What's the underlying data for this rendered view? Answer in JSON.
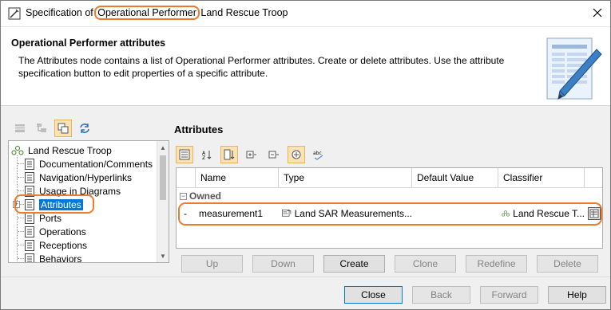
{
  "window": {
    "title_prefix": "Specification of ",
    "title_highlight": "Operational Performer",
    "title_suffix": " Land Rescue Troop"
  },
  "header": {
    "title": "Operational Performer attributes",
    "description": "The Attributes node contains a list of Operational Performer attributes. Create or delete attributes. Use the attribute specification button to edit properties of a specific attribute."
  },
  "tree": {
    "root": "Land Rescue Troop",
    "items": [
      {
        "label": "Documentation/Comments",
        "selected": false
      },
      {
        "label": "Navigation/Hyperlinks",
        "selected": false
      },
      {
        "label": "Usage in Diagrams",
        "selected": false
      },
      {
        "label": "Attributes",
        "selected": true
      },
      {
        "label": "Ports",
        "selected": false
      },
      {
        "label": "Operations",
        "selected": false
      },
      {
        "label": "Receptions",
        "selected": false
      },
      {
        "label": "Behaviors",
        "selected": false
      }
    ]
  },
  "attributes": {
    "title": "Attributes",
    "columns": [
      "Name",
      "Type",
      "Default Value",
      "Classifier"
    ],
    "group_label": "Owned",
    "rows": [
      {
        "marker": "-",
        "name": "measurement1",
        "type": "Land SAR Measurements...",
        "default_value": "",
        "classifier": "Land Rescue T..."
      }
    ]
  },
  "action_buttons": {
    "up": "Up",
    "down": "Down",
    "create": "Create",
    "clone": "Clone",
    "redefine": "Redefine",
    "delete": "Delete"
  },
  "footer_buttons": {
    "close": "Close",
    "back": "Back",
    "forward": "Forward",
    "help": "Help"
  },
  "colors": {
    "highlight": "#ee7a2d",
    "selection": "#0078d7",
    "toggle_active": "#fbe2b5"
  }
}
